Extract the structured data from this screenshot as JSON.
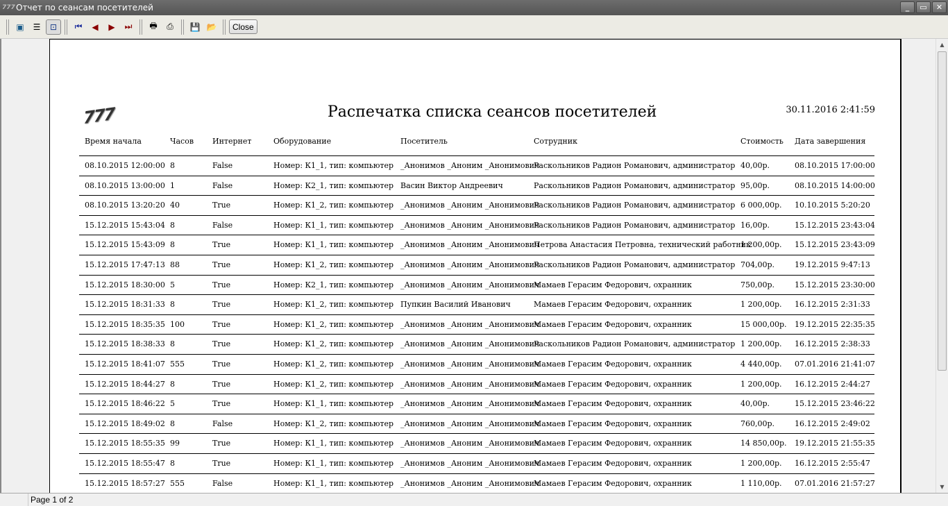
{
  "window": {
    "title": "Отчет по сеансам посетителей",
    "app_icon": "777"
  },
  "toolbar": {
    "close_label": "Close"
  },
  "report": {
    "logo": "777",
    "title": "Распечатка списка сеансов посетителей",
    "date": "30.11.2016 2:41:59",
    "columns": [
      "Время начала",
      "Часов",
      "Интернет",
      "Оборудование",
      "Посетитель",
      "Сотрудник",
      "Стоимость",
      "Дата завершения"
    ],
    "rows": [
      [
        "08.10.2015 12:00:00",
        "8",
        "False",
        "Номер: К1_1, тип: компьютер",
        "_Анонимов _Аноним _Анонимович",
        "Раскольников Радион Романович, администратор",
        "40,00р.",
        "08.10.2015 17:00:00"
      ],
      [
        "08.10.2015 13:00:00",
        "1",
        "False",
        "Номер: К2_1, тип: компьютер",
        "Васин Виктор Андреевич",
        "Раскольников Радион Романович, администратор",
        "95,00р.",
        "08.10.2015 14:00:00"
      ],
      [
        "08.10.2015 13:20:20",
        "40",
        "True",
        "Номер: К1_2, тип: компьютер",
        "_Анонимов _Аноним _Анонимович",
        "Раскольников Радион Романович, администратор",
        "6 000,00р.",
        "10.10.2015 5:20:20"
      ],
      [
        "15.12.2015 15:43:04",
        "8",
        "False",
        "Номер: К1_1, тип: компьютер",
        "_Анонимов _Аноним _Анонимович",
        "Раскольников Радион Романович, администратор",
        "16,00р.",
        "15.12.2015 23:43:04"
      ],
      [
        "15.12.2015 15:43:09",
        "8",
        "True",
        "Номер: К1_1, тип: компьютер",
        "_Анонимов _Аноним _Анонимович",
        "Петрова Анастасия Петровна, технический работник",
        "1 200,00р.",
        "15.12.2015 23:43:09"
      ],
      [
        "15.12.2015 17:47:13",
        "88",
        "True",
        "Номер: К1_2, тип: компьютер",
        "_Анонимов _Аноним _Анонимович",
        "Раскольников Радион Романович, администратор",
        "704,00р.",
        "19.12.2015 9:47:13"
      ],
      [
        "15.12.2015 18:30:00",
        "5",
        "True",
        "Номер: К2_1, тип: компьютер",
        "_Анонимов _Аноним _Анонимович",
        "Мамаев Герасим Федорович, охранник",
        "750,00р.",
        "15.12.2015 23:30:00"
      ],
      [
        "15.12.2015 18:31:33",
        "8",
        "True",
        "Номер: К1_2, тип: компьютер",
        "Пупкин Василий Иванович",
        "Мамаев Герасим Федорович, охранник",
        "1 200,00р.",
        "16.12.2015 2:31:33"
      ],
      [
        "15.12.2015 18:35:35",
        "100",
        "True",
        "Номер: К1_2, тип: компьютер",
        "_Анонимов _Аноним _Анонимович",
        "Мамаев Герасим Федорович, охранник",
        "15 000,00р.",
        "19.12.2015 22:35:35"
      ],
      [
        "15.12.2015 18:38:33",
        "8",
        "True",
        "Номер: К1_2, тип: компьютер",
        "_Анонимов _Аноним _Анонимович",
        "Раскольников Радион Романович, администратор",
        "1 200,00р.",
        "16.12.2015 2:38:33"
      ],
      [
        "15.12.2015 18:41:07",
        "555",
        "True",
        "Номер: К1_2, тип: компьютер",
        "_Анонимов _Аноним _Анонимович",
        "Мамаев Герасим Федорович, охранник",
        "4 440,00р.",
        "07.01.2016 21:41:07"
      ],
      [
        "15.12.2015 18:44:27",
        "8",
        "True",
        "Номер: К1_2, тип: компьютер",
        "_Анонимов _Аноним _Анонимович",
        "Мамаев Герасим Федорович, охранник",
        "1 200,00р.",
        "16.12.2015 2:44:27"
      ],
      [
        "15.12.2015 18:46:22",
        "5",
        "True",
        "Номер: К1_1, тип: компьютер",
        "_Анонимов _Аноним _Анонимович",
        "Мамаев Герасим Федорович, охранник",
        "40,00р.",
        "15.12.2015 23:46:22"
      ],
      [
        "15.12.2015 18:49:02",
        "8",
        "False",
        "Номер: К1_2, тип: компьютер",
        "_Анонимов _Аноним _Анонимович",
        "Мамаев Герасим Федорович, охранник",
        "760,00р.",
        "16.12.2015 2:49:02"
      ],
      [
        "15.12.2015 18:55:35",
        "99",
        "True",
        "Номер: К1_1, тип: компьютер",
        "_Анонимов _Аноним _Анонимович",
        "Мамаев Герасим Федорович, охранник",
        "14 850,00р.",
        "19.12.2015 21:55:35"
      ],
      [
        "15.12.2015 18:55:47",
        "8",
        "True",
        "Номер: К1_1, тип: компьютер",
        "_Анонимов _Аноним _Анонимович",
        "Мамаев Герасим Федорович, охранник",
        "1 200,00р.",
        "16.12.2015 2:55:47"
      ],
      [
        "15.12.2015 18:57:27",
        "555",
        "False",
        "Номер: К1_1, тип: компьютер",
        "_Анонимов _Аноним _Анонимович",
        "Мамаев Герасим Федорович, охранник",
        "1 110,00р.",
        "07.01.2016 21:57:27"
      ]
    ]
  },
  "status": {
    "page": "Page 1 of 2"
  }
}
